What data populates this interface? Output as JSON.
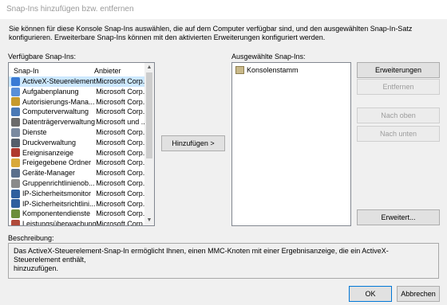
{
  "window": {
    "title": "Snap-Ins hinzufügen bzw. entfernen"
  },
  "intro": {
    "line1": "Sie können für diese Konsole Snap-Ins auswählen, die auf dem Computer verfügbar sind, und den ausgewählten Snap-In-Satz",
    "line2": "konfigurieren. Erweiterbare Snap-Ins können mit den aktivierten Erweiterungen konfiguriert werden."
  },
  "available": {
    "label": "Verfügbare Snap-Ins:",
    "col_snapin": "Snap-In",
    "col_vendor": "Anbieter",
    "items": [
      {
        "name": "ActiveX-Steuerelement",
        "vendor": "Microsoft Corp...",
        "icon": "activex-icon",
        "color": "#3a7bd5"
      },
      {
        "name": "Aufgabenplanung",
        "vendor": "Microsoft Corp...",
        "icon": "clock-icon",
        "color": "#5a8fd8"
      },
      {
        "name": "Autorisierungs-Mana...",
        "vendor": "Microsoft Corp...",
        "icon": "key-icon",
        "color": "#c79a2d"
      },
      {
        "name": "Computerverwaltung",
        "vendor": "Microsoft Corp...",
        "icon": "computer-icon",
        "color": "#4a79b5"
      },
      {
        "name": "Datenträgerverwaltung",
        "vendor": "Microsoft und ...",
        "icon": "disk-icon",
        "color": "#6b6b6b"
      },
      {
        "name": "Dienste",
        "vendor": "Microsoft Corp...",
        "icon": "gear-icon",
        "color": "#7a8aa0"
      },
      {
        "name": "Druckverwaltung",
        "vendor": "Microsoft Corp...",
        "icon": "printer-icon",
        "color": "#555e6b"
      },
      {
        "name": "Ereignisanzeige",
        "vendor": "Microsoft Corp...",
        "icon": "event-viewer-icon",
        "color": "#b03a2e"
      },
      {
        "name": "Freigegebene Ordner",
        "vendor": "Microsoft Corp...",
        "icon": "folder-icon",
        "color": "#d9a93a"
      },
      {
        "name": "Geräte-Manager",
        "vendor": "Microsoft Corp...",
        "icon": "device-manager-icon",
        "color": "#5a6f8c"
      },
      {
        "name": "Gruppenrichtlinienob...",
        "vendor": "Microsoft Corp...",
        "icon": "policy-icon",
        "color": "#8a8a8a"
      },
      {
        "name": "IP-Sicherheitsmonitor",
        "vendor": "Microsoft Corp...",
        "icon": "monitor-icon",
        "color": "#2f5f9e"
      },
      {
        "name": "IP-Sicherheitsrichtlini...",
        "vendor": "Microsoft Corp...",
        "icon": "shield-icon",
        "color": "#2f5f9e"
      },
      {
        "name": "Komponentendienste",
        "vendor": "Microsoft Corp...",
        "icon": "component-icon",
        "color": "#6b8e3a"
      },
      {
        "name": "Leistungsüberwachung",
        "vendor": "Microsoft Corp...",
        "icon": "performance-icon",
        "color": "#b04a3a"
      }
    ]
  },
  "buttons": {
    "add": "Hinzufügen >",
    "edit_extensions": "Erweiterungen bearbeiten...",
    "remove": "Entfernen",
    "move_up": "Nach oben",
    "move_down": "Nach unten",
    "advanced": "Erweitert...",
    "ok": "OK",
    "cancel": "Abbrechen"
  },
  "selected": {
    "label": "Ausgewählte Snap-Ins:",
    "items": [
      {
        "name": "Konsolenstamm",
        "icon": "folder-icon"
      }
    ]
  },
  "description": {
    "label": "Beschreibung:",
    "line1": "Das ActiveX-Steuerelement-Snap-In ermöglicht Ihnen, einen MMC-Knoten mit einer Ergebnisanzeige, die ein ActiveX-Steuerelement enthält,",
    "line2": "hinzuzufügen."
  },
  "colors": {
    "selection": "#cce8ff",
    "focus_border": "#0078d7"
  }
}
